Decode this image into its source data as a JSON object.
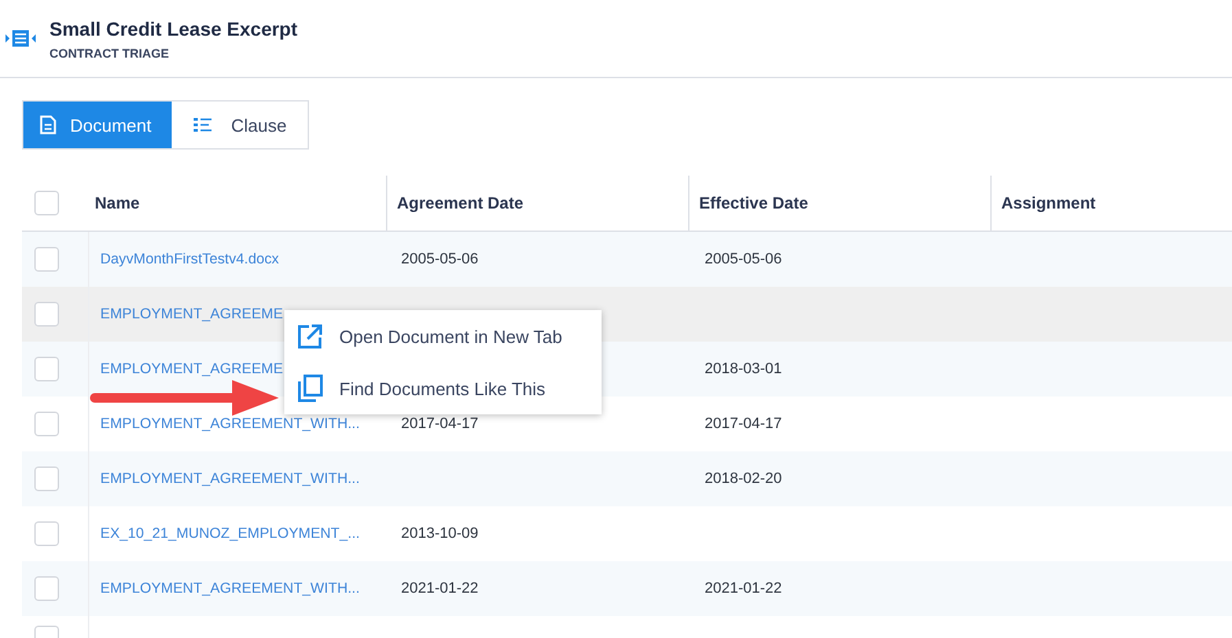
{
  "header": {
    "title": "Small Credit Lease Excerpt",
    "subtitle": "CONTRACT TRIAGE"
  },
  "view_tabs": [
    {
      "label": "Document",
      "selected": true,
      "kind": "document"
    },
    {
      "label": "Clause",
      "selected": false,
      "kind": "clause"
    }
  ],
  "table": {
    "select_all": {
      "checked": false
    },
    "columns": [
      "Name",
      "Agreement Date",
      "Effective Date",
      "Assignment"
    ],
    "rows": [
      {
        "cells": [
          "DayvMonthFirstTestv4.docx",
          "2005-05-06",
          "2005-05-06"
        ],
        "checked": false,
        "hovered": false
      },
      {
        "cells": [
          "EMPLOYMENT_AGREEME"
        ],
        "checked": false,
        "hovered": true
      },
      {
        "cells": [
          "EMPLOYMENT_AGREEME",
          "",
          "2018-03-01"
        ],
        "checked": false,
        "hovered": false
      },
      {
        "cells": [
          "EMPLOYMENT_AGREEMENT_WITH...",
          "2017-04-17",
          "2017-04-17"
        ],
        "checked": false,
        "hovered": false
      },
      {
        "cells": [
          "EMPLOYMENT_AGREEMENT_WITH...",
          "",
          "2018-02-20"
        ],
        "checked": false,
        "hovered": false
      },
      {
        "cells": [
          "EX_10_21_MUNOZ_EMPLOYMENT_...",
          "2013-10-09"
        ],
        "checked": false,
        "hovered": false
      },
      {
        "cells": [
          "EMPLOYMENT_AGREEMENT_WITH...",
          "2021-01-22",
          "2021-01-22"
        ],
        "checked": false,
        "hovered": false
      },
      {
        "cells": [],
        "checked": false,
        "hovered": false
      }
    ]
  },
  "context_menu": {
    "items": [
      {
        "label": "Open Document in New Tab",
        "kind": "open"
      },
      {
        "label": "Find Documents Like This",
        "kind": "copy"
      }
    ]
  }
}
